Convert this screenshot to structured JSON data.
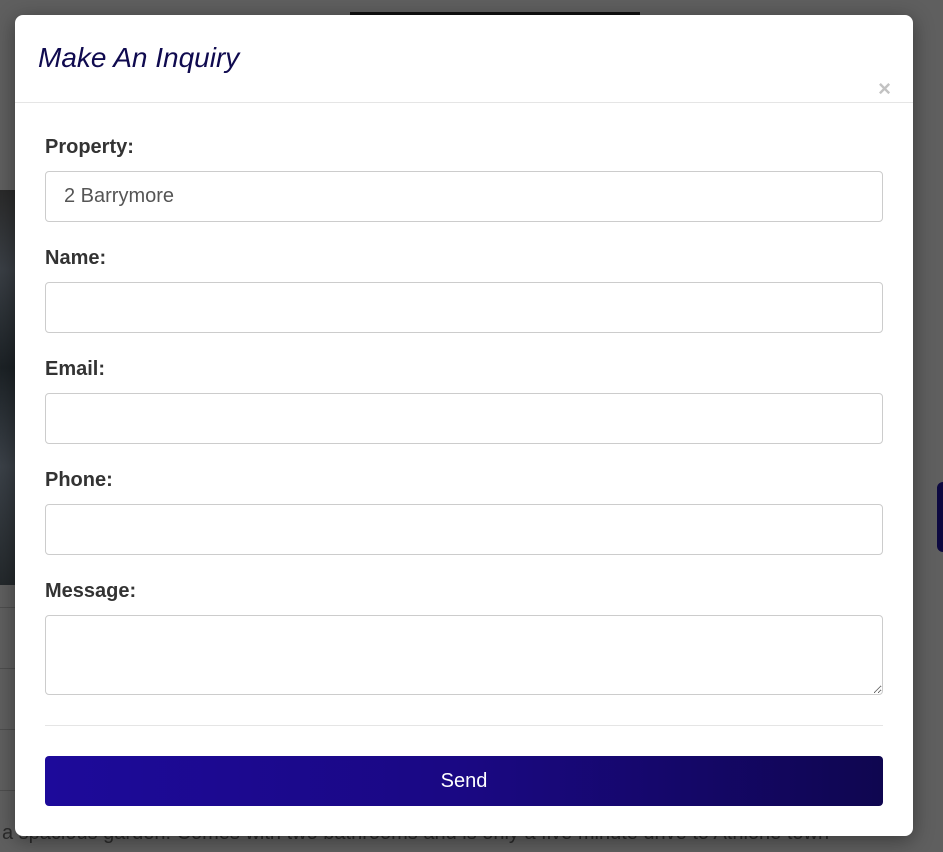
{
  "colors": {
    "title": "#0f0a4f",
    "send_button_start": "#1d0a9a",
    "send_button_end": "#0f0650"
  },
  "background_page": {
    "description_text": "a spacious garden. Comes with two bathrooms and is only a five minute drive to Athlone town"
  },
  "modal": {
    "title": "Make An Inquiry",
    "close_label": "×",
    "fields": {
      "property": {
        "label": "Property:",
        "value": "2 Barrymore"
      },
      "name": {
        "label": "Name:",
        "value": ""
      },
      "email": {
        "label": "Email:",
        "value": ""
      },
      "phone": {
        "label": "Phone:",
        "value": ""
      },
      "message": {
        "label": "Message:",
        "value": ""
      }
    },
    "send_label": "Send"
  }
}
